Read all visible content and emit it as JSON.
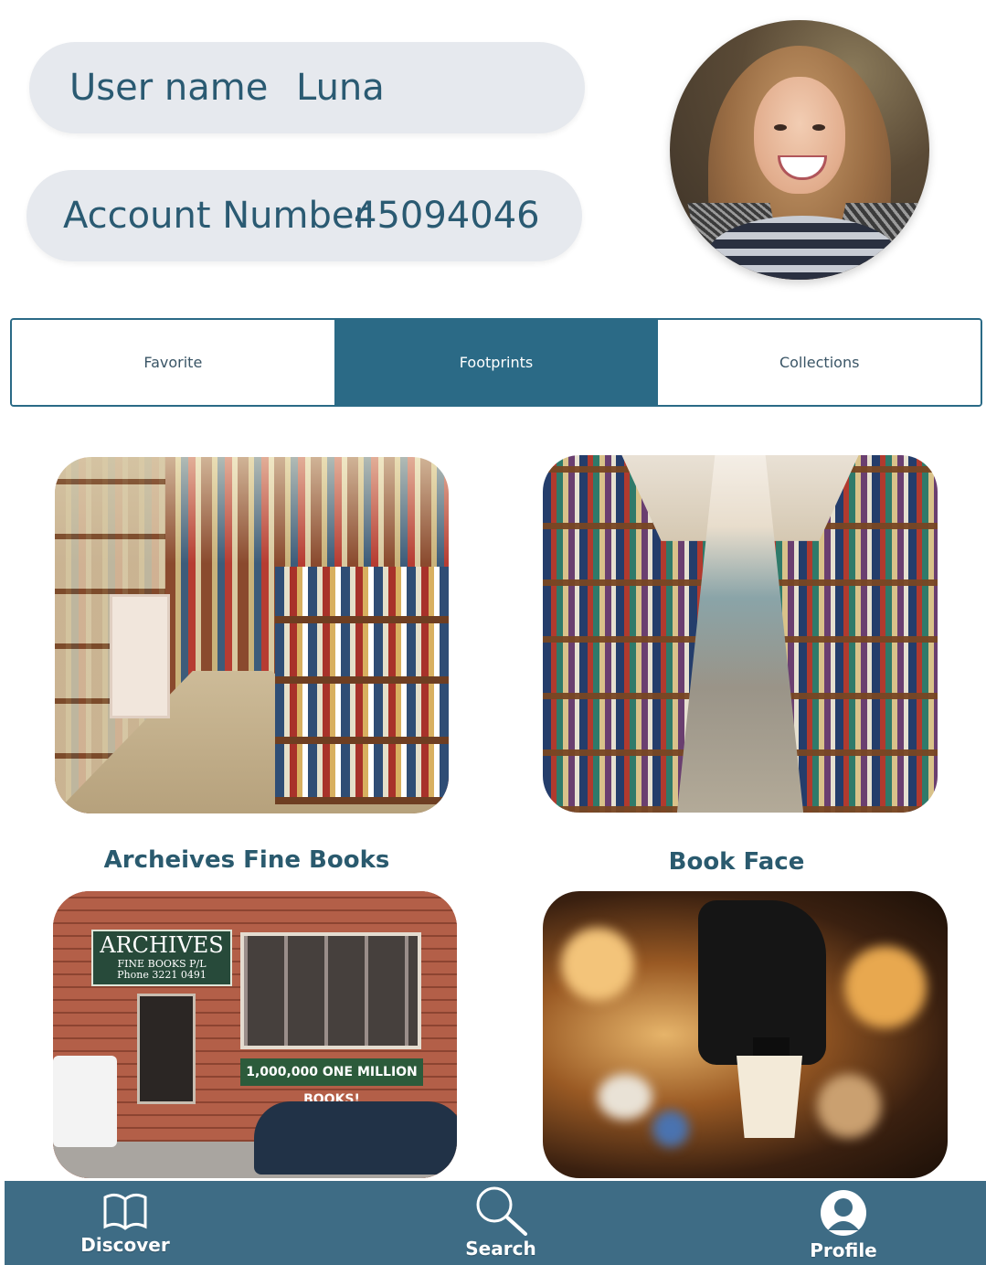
{
  "profile": {
    "username_label": "User name",
    "username_value": "Luna",
    "account_label": "Account Number",
    "account_value": "45094046"
  },
  "tabs": [
    {
      "label": "Favorite",
      "active": false
    },
    {
      "label": "Footprints",
      "active": true
    },
    {
      "label": "Collections",
      "active": false
    }
  ],
  "cards": [
    {
      "title": "Archeives Fine Books",
      "image": "bookstore-aisle-photo"
    },
    {
      "title": "Book Face",
      "image": "bookshelf-corridor-photo"
    },
    {
      "title": "",
      "image": "archives-storefront-photo",
      "sign_text": "ARCHIVES",
      "sign_sub": "FINE BOOKS P/L",
      "sign_phone": "Phone 3221 0491",
      "banner_text": "1,000,000 ONE MILLION BOOKS!"
    },
    {
      "title": "",
      "image": "coffee-grinder-photo"
    }
  ],
  "nav": [
    {
      "label": "Discover",
      "icon": "book-icon"
    },
    {
      "label": "Search",
      "icon": "search-icon"
    },
    {
      "label": "Profile",
      "icon": "profile-icon"
    }
  ],
  "colors": {
    "accent": "#2b6a86",
    "nav_bg": "#3e6c85",
    "pill_bg": "#e6e9ee",
    "text": "#2a5a72"
  }
}
